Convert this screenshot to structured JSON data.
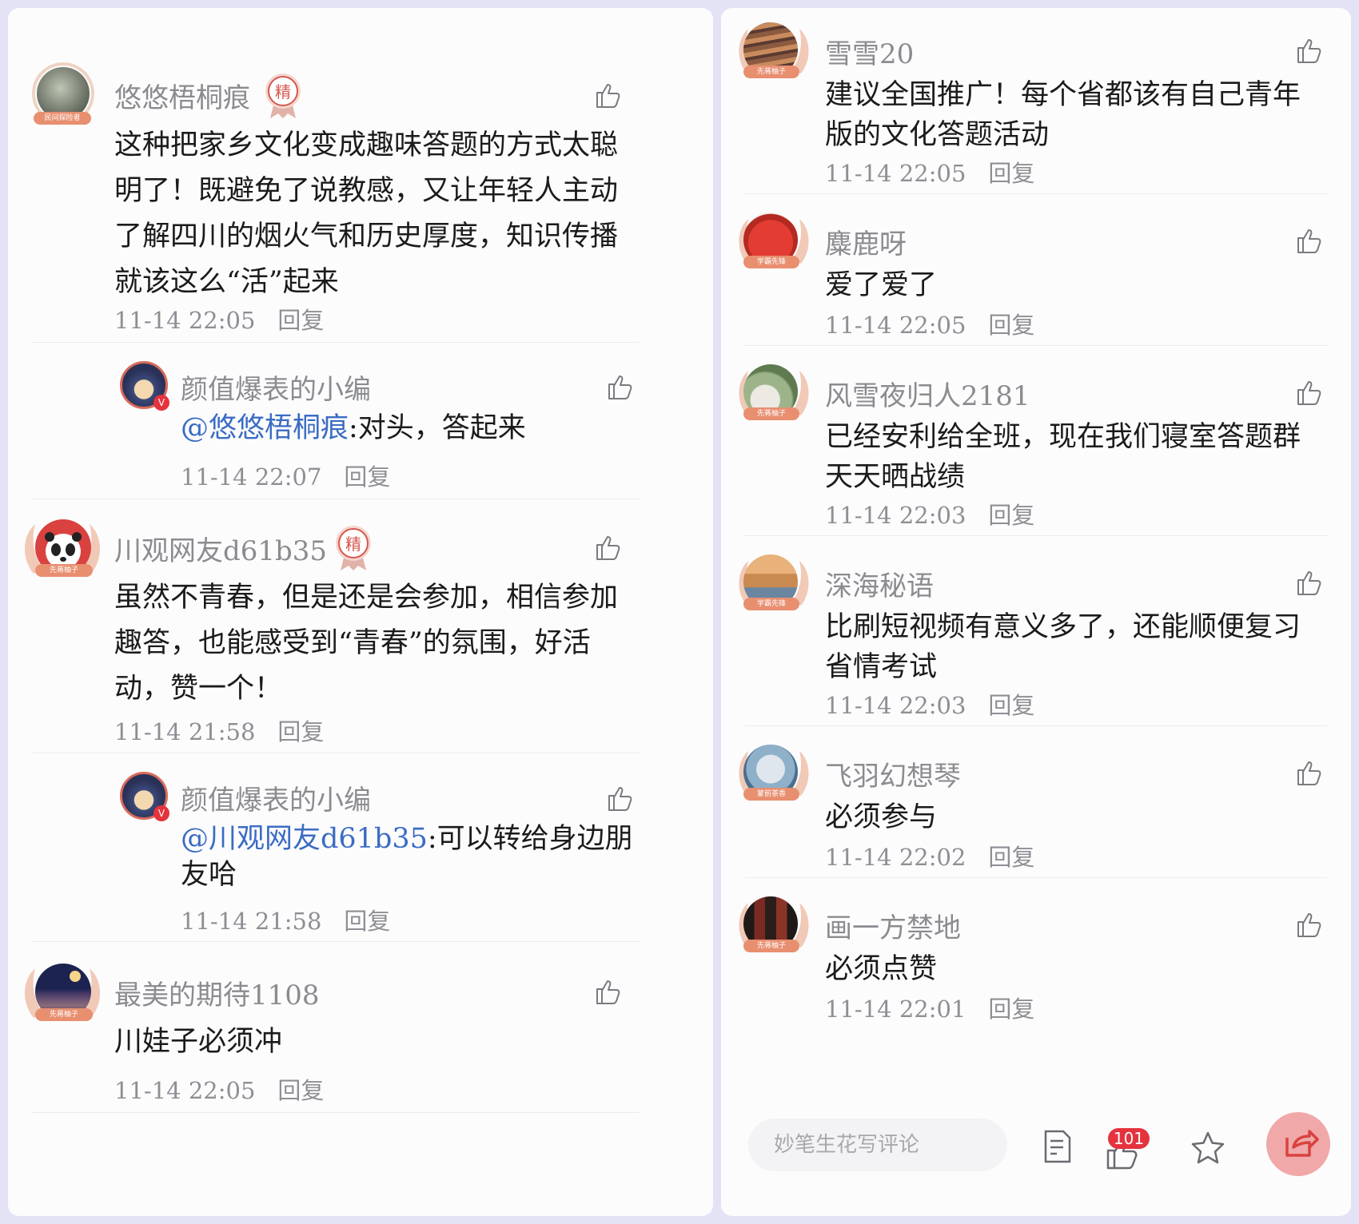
{
  "left_comments": [
    {
      "user": "悠悠梧桐痕",
      "badge": "精",
      "avatar_label": "民间探险者",
      "text": "这种把家乡文化变成趣味答题的方式太聪明了！既避免了说教感，又让年轻人主动了解四川的烟火气和历史厚度，知识传播就该这么“活”起来",
      "time": "11-14 22:05",
      "reply": "回复"
    },
    {
      "user": "颜值爆表的小编",
      "mention": "@悠悠梧桐痕",
      "text": ":对头，答起来",
      "time": "11-14 22:07",
      "reply": "回复"
    },
    {
      "user": "川观网友d61b35",
      "badge": "精",
      "avatar_label": "先蒋柚子",
      "text": "虽然不青春，但是还是会参加，相信参加趣答，也能感受到“青春”的氛围，好活动，赞一个！",
      "time": "11-14 21:58",
      "reply": "回复"
    },
    {
      "user": "颜值爆表的小编",
      "mention": "@川观网友d61b35",
      "text": ":可以转给身边朋友哈",
      "time": "11-14 21:58",
      "reply": "回复"
    },
    {
      "user": "最美的期待1108",
      "avatar_label": "先蒋柚子",
      "text": "川娃子必须冲",
      "time": "11-14 22:05",
      "reply": "回复"
    }
  ],
  "right_comments": [
    {
      "user": "雪雪20",
      "avatar_label": "先蒋柚子",
      "text": "建议全国推广！每个省都该有自己青年版的文化答题活动",
      "time": "11-14 22:05",
      "reply": "回复"
    },
    {
      "user": "麋鹿呀",
      "avatar_label": "学霸先锋",
      "text": "爱了爱了",
      "time": "11-14 22:05",
      "reply": "回复"
    },
    {
      "user": "风雪夜归人2181",
      "avatar_label": "先蒋柚子",
      "text": "已经安利给全班，现在我们寝室答题群天天晒战绩",
      "time": "11-14 22:03",
      "reply": "回复"
    },
    {
      "user": "深海秘语",
      "avatar_label": "学霸先锋",
      "text": "比刷短视频有意义多了，还能顺便复习省情考试",
      "time": "11-14 22:03",
      "reply": "回复"
    },
    {
      "user": "飞羽幻想琴",
      "avatar_label": "蒙前茶香",
      "text": "必须参与",
      "time": "11-14 22:02",
      "reply": "回复"
    },
    {
      "user": "画一方禁地",
      "avatar_label": "先蒋柚子",
      "text": "必须点赞",
      "time": "11-14 22:01",
      "reply": "回复"
    }
  ],
  "bottom_bar": {
    "input_placeholder": "妙笔生花写评论",
    "like_count": "101"
  },
  "colors": {
    "mention": "#3b6cc4",
    "badge": "#d4584e",
    "like_badge": "#e5333e",
    "share": "#f1a8a8"
  }
}
